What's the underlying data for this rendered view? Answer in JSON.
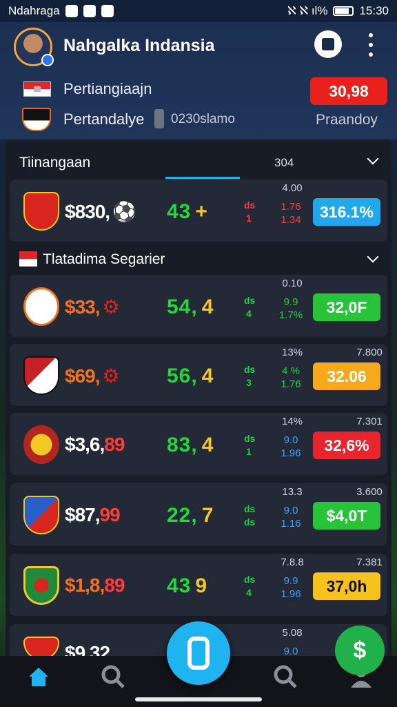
{
  "status_bar": {
    "carrier": "Ndahraga",
    "indicators": "ℵ ℵ ıl%",
    "time": "15:30"
  },
  "header": {
    "title": "Nahgalka Indansia",
    "row1": {
      "label": "Pertiangiaajn",
      "score": "30,98"
    },
    "row2": {
      "label": "Pertandalye",
      "sub": "0230slamo",
      "right": "Praandoy"
    }
  },
  "section": {
    "title": "Tiinangaan",
    "number": "304",
    "group_label": "Tlatadima Segarier"
  },
  "rows": [
    {
      "price": "$830,",
      "price_suffix": "⚽",
      "mid1": "43",
      "mid2": "+",
      "mini": [
        "ds",
        "1"
      ],
      "stack": [
        "1.76",
        "1.34"
      ],
      "top": "4.00",
      "top_right": "",
      "badge": "316.1%",
      "badge_color": "#1fa8ee",
      "price_color": "#ffffff",
      "stack_color": "#ff3b3b",
      "mini_color": "#ff3b3b"
    },
    {
      "price": "$33,",
      "price_suffix": "⚙",
      "mid1": "54,",
      "mid2": "4",
      "mini": [
        "ds",
        "4"
      ],
      "stack": [
        "9.9",
        "1.7%"
      ],
      "top": "0.10",
      "top_right": "",
      "badge": "32,0F",
      "badge_color": "#27c43a",
      "price_color": "#f5711c",
      "stack_color": "#22d040",
      "mini_color": "#22d040"
    },
    {
      "price": "$69,",
      "price_suffix": "⚙",
      "mid1": "56,",
      "mid2": "4",
      "mini": [
        "ds",
        "3"
      ],
      "stack": [
        "4 %",
        "1.76"
      ],
      "top": "13%",
      "top_right": "7.800",
      "badge": "32.06",
      "badge_color": "#f7a91c",
      "price_color": "#f5711c",
      "stack_color": "#22d040",
      "mini_color": "#22d040"
    },
    {
      "price": "$3,6,",
      "price_suffix": "89",
      "mid1": "83,",
      "mid2": "4",
      "mini": [
        "ds",
        "1"
      ],
      "stack": [
        "9.0",
        "1.96"
      ],
      "top": "14%",
      "top_right": "7.301",
      "badge": "32,6%",
      "badge_color": "#e8252c",
      "price_color": "#ffffff",
      "stack_color": "#3fa0ff",
      "mini_color": "#22d040"
    },
    {
      "price": "$87,",
      "price_suffix": "99",
      "mid1": "22,",
      "mid2": "7",
      "mini": [
        "ds",
        "ds"
      ],
      "stack": [
        "9.0",
        "1.16"
      ],
      "top": "13.3",
      "top_right": "3.600",
      "badge": "$4,0T",
      "badge_color": "#27c43a",
      "price_color": "#ffffff",
      "stack_color": "#3fa0ff",
      "mini_color": "#22d040"
    },
    {
      "price": "$1,8,",
      "price_suffix": "89",
      "mid1": "43",
      "mid2": "9",
      "mini": [
        "ds",
        "4"
      ],
      "stack": [
        "9.9",
        "1.96"
      ],
      "top": "7.8.8",
      "top_right": "7.381",
      "badge": "37,0h",
      "badge_color": "#f7c21c",
      "price_color": "#f5711c",
      "stack_color": "#3fa0ff",
      "mini_color": "#22d040"
    }
  ],
  "last_row": {
    "price": "$9,32,",
    "top": "5.08",
    "stack": "9.0"
  },
  "colors": {
    "accent": "#1fb4f0",
    "green": "#25d83a",
    "yellow": "#f2c824",
    "red": "#e8211d"
  },
  "nav": {
    "items": [
      "home-icon",
      "search-stats-icon",
      "search-icon",
      "profile-icon"
    ],
    "fab": "scan-icon"
  }
}
